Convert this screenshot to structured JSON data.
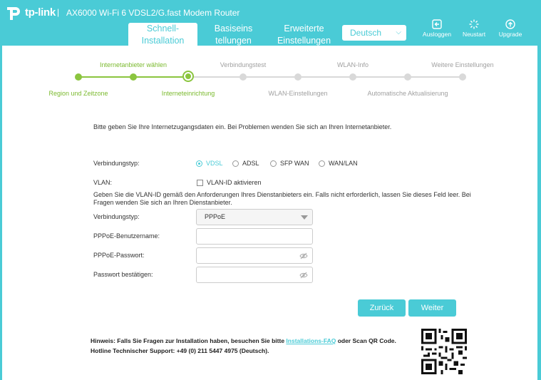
{
  "header": {
    "brand": "tp-link",
    "separator": "|",
    "model": "AX6000 Wi-Fi 6 VDSL2/G.fast Modem Router",
    "tabs": [
      {
        "line1": "Schnell-",
        "line2": "Installation"
      },
      {
        "line1": "Basiseins",
        "line2": "tellungen"
      },
      {
        "line1": "Erweiterte",
        "line2": "Einstellungen"
      }
    ],
    "language": "Deutsch",
    "tools": [
      {
        "label": "Ausloggen",
        "icon": "logout-icon"
      },
      {
        "label": "Neustart",
        "icon": "reboot-icon"
      },
      {
        "label": "Upgrade",
        "icon": "upgrade-icon"
      }
    ]
  },
  "steps": {
    "top": [
      "Internetanbieter wählen",
      "Verbindungstest",
      "WLAN-Info",
      "Weitere Einstellungen"
    ],
    "bottom": [
      "Region und Zeitzone",
      "Interneteinrichtung",
      "WLAN-Einstellungen",
      "Automatische Aktualisierung"
    ],
    "current_index": 2
  },
  "form": {
    "intro": "Bitte geben Sie Ihre Internetzugangsdaten ein. Bei Problemen wenden Sie sich an Ihren Internetanbieter.",
    "connection_type_label": "Verbindungstyp:",
    "radio_options": [
      "VDSL",
      "ADSL",
      "SFP WAN",
      "WAN/LAN"
    ],
    "selected_radio": "VDSL",
    "vlan_label": "VLAN:",
    "vlan_checkbox": "VLAN-ID aktivieren",
    "vlan_note_line1": "Geben Sie die VLAN-ID gemäß den Anforderungen Ihres Dienstanbieters ein. Falls nicht erforderlich, lassen Sie dieses Feld leer.  Bei",
    "vlan_note_line2": "Fragen wenden Sie sich an Ihren Dienstanbieter.",
    "conn_type2_label": "Verbindungstyp:",
    "conn_type2_value": "PPPoE",
    "username_label": "PPPoE-Benutzername:",
    "username_value": "",
    "password_label": "PPPoE-Passwort:",
    "password_value": "",
    "confirm_label": "Passwort bestätigen:",
    "confirm_value": ""
  },
  "buttons": {
    "back": "Zurück",
    "next": "Weiter"
  },
  "footer": {
    "hint_prefix": "Hinweis: Falls Sie Fragen zur Installation haben, besuchen Sie bitte ",
    "hint_link": "Installations-FAQ",
    "hint_suffix": " oder Scan QR Code.",
    "hotline": "Hotline Technischer Support: +49 (0) 211 5447 4975 (Deutsch)."
  },
  "colors": {
    "accent": "#4acbd6",
    "progress": "#8bc53f",
    "inactive": "#d9d9d9"
  }
}
